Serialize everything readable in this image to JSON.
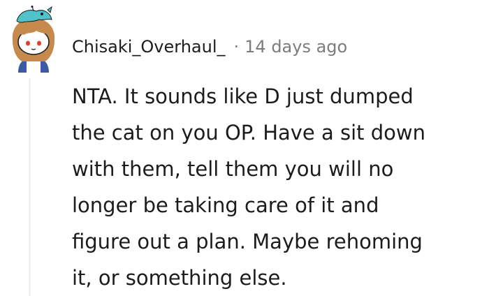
{
  "comment": {
    "author": "Chisaki_Overhaul_",
    "separator": "·",
    "time_ago": "14 days ago",
    "body_lines": [
      "NTA. It sounds like D just dumped",
      "the cat on you OP. Have a sit down",
      "with them, tell them you will no",
      "longer be taking care of it and",
      "figure out a plan. Maybe rehoming",
      "it, or something else."
    ]
  },
  "colors": {
    "text": "#1c1c1c",
    "meta": "#7c7c7c",
    "thread_line": "#edeff1",
    "avatar_hat": "#4fc3c9",
    "avatar_hair": "#c68a4e"
  },
  "icons": {
    "avatar": "snoo-avatar-icon"
  }
}
